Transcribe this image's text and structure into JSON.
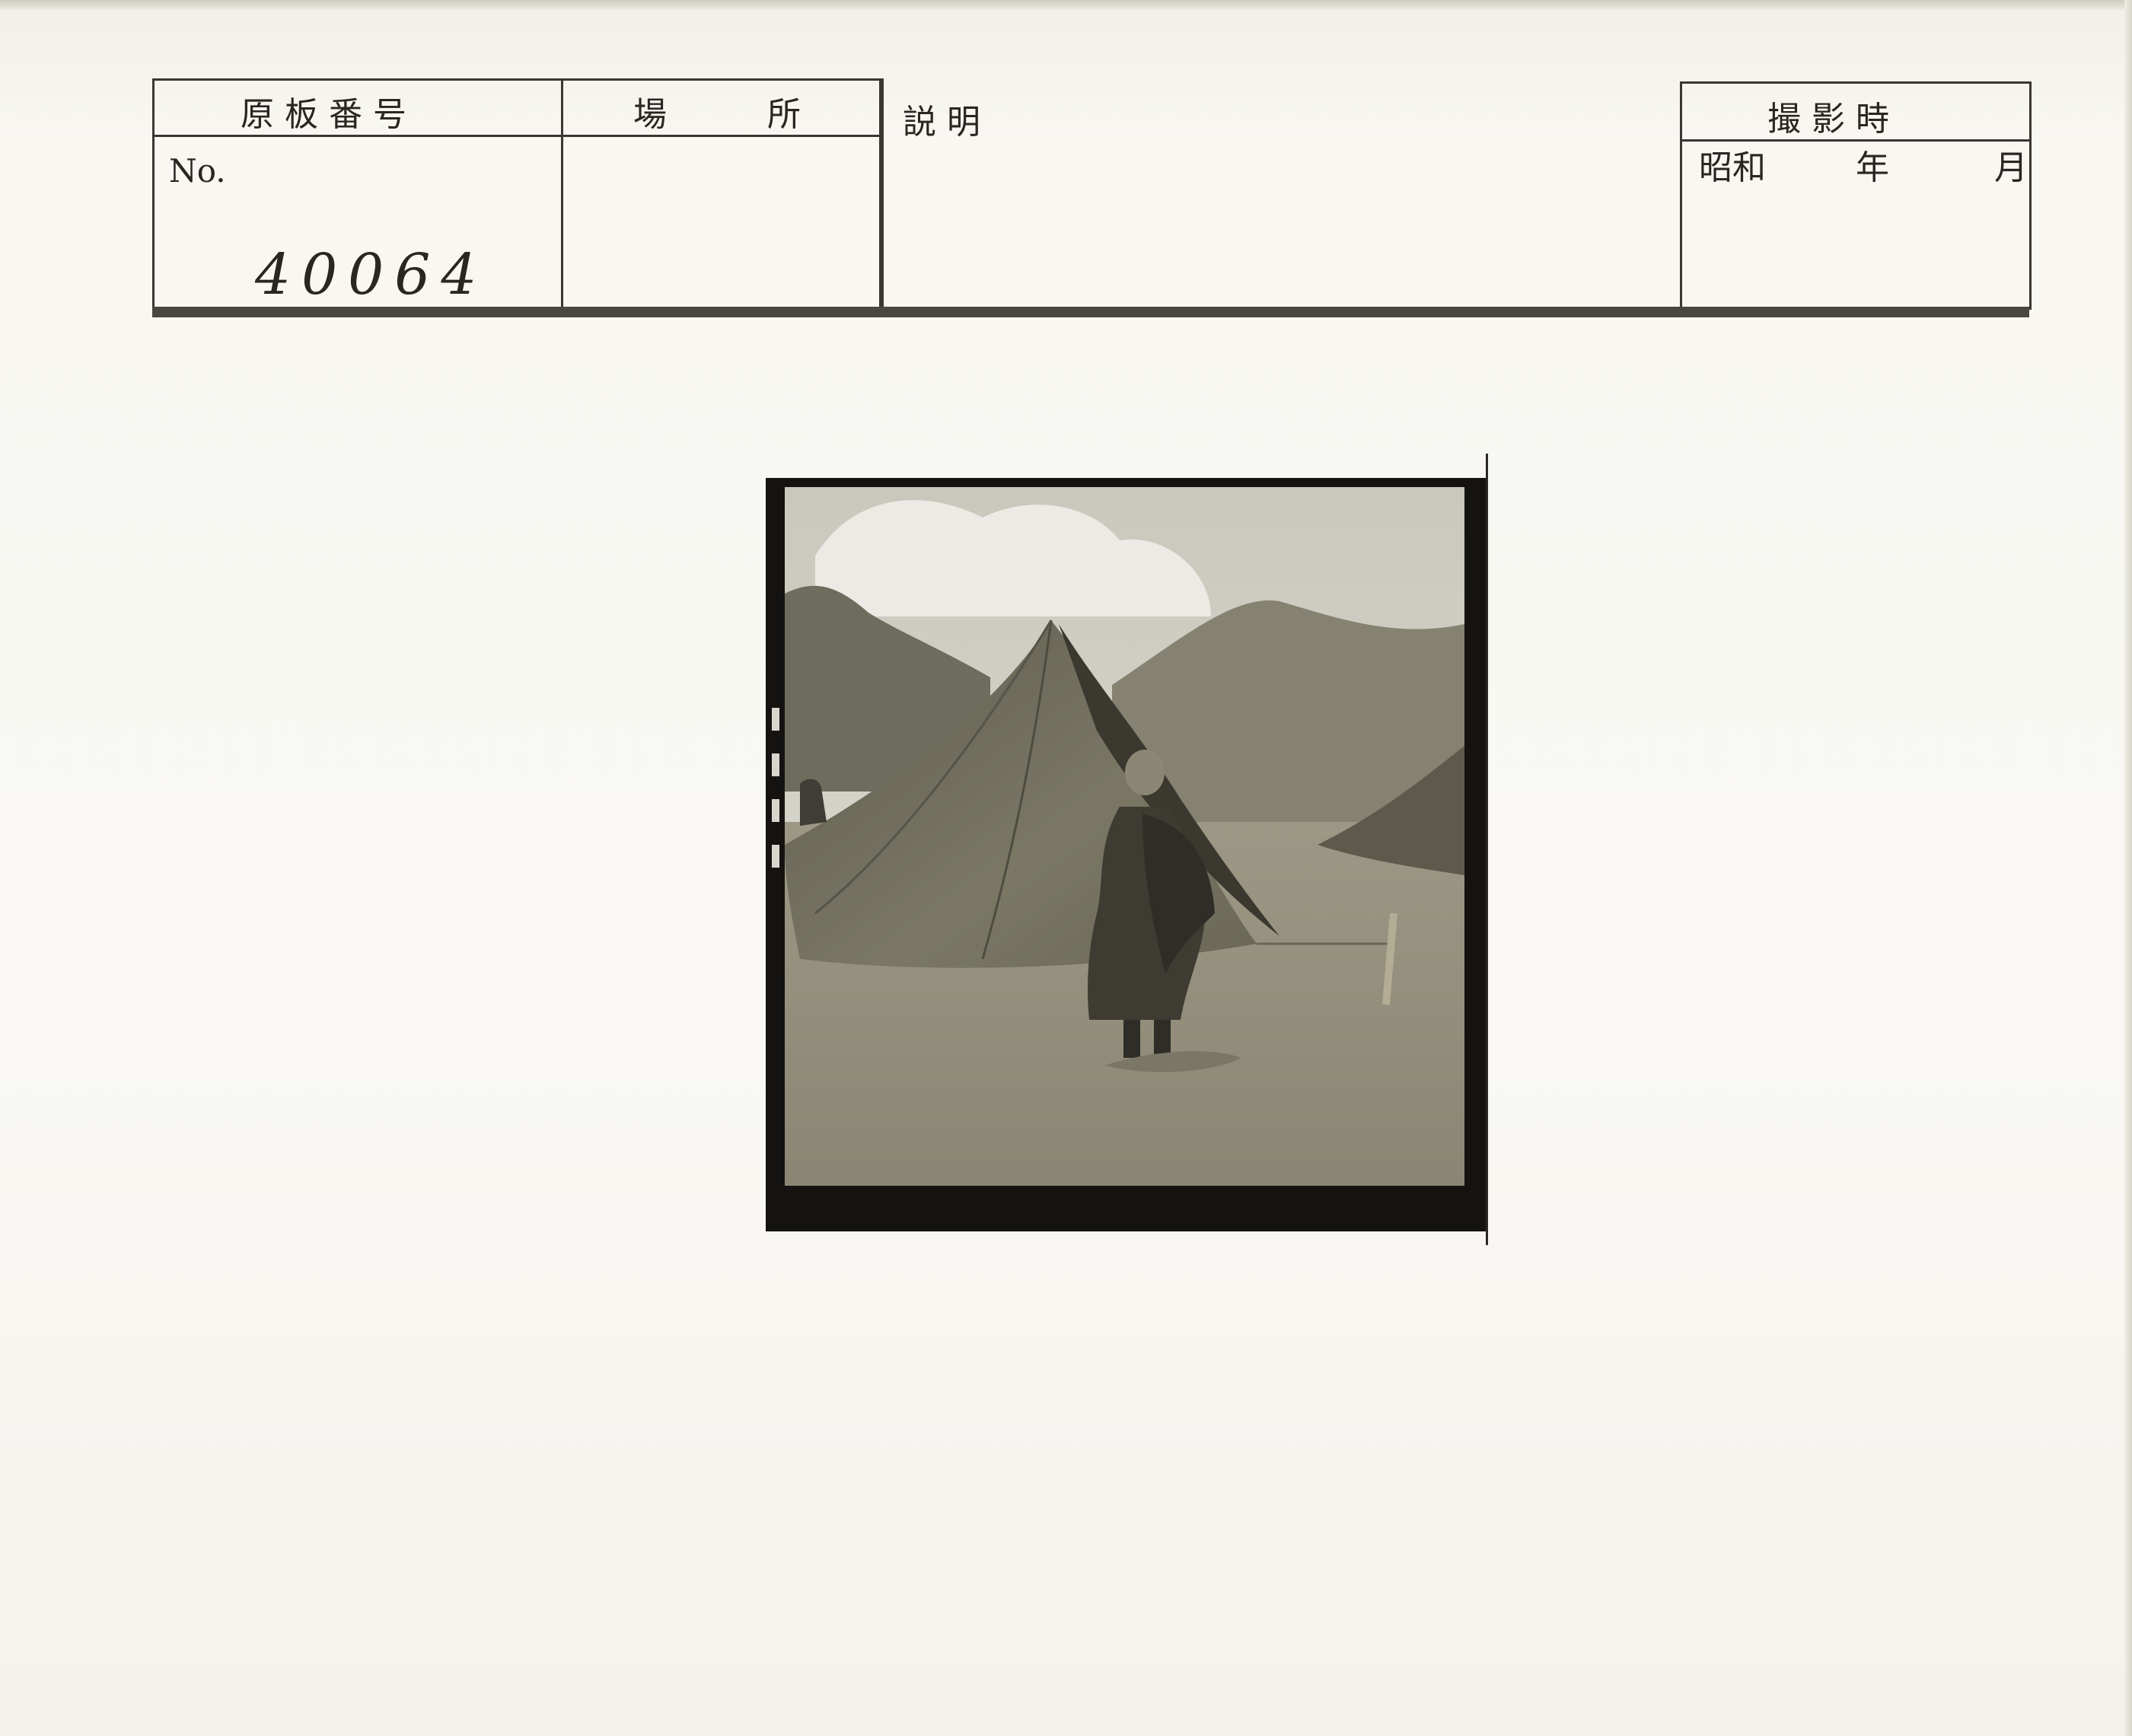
{
  "record_card": {
    "plate_number_header": "原 板 番 号",
    "place_header": "場　　　所",
    "description_header": "説 明",
    "shooting_time_header": "撮 影 時",
    "era": "昭和",
    "year_unit": "年",
    "month_unit": "月",
    "no_prefix": "No.",
    "plate_number_value": "40064"
  },
  "photograph": {
    "subject": "boy-monk-in-robe-before-tent",
    "tone": "#8c8a7a"
  },
  "colors": {
    "paper": "#f8f7f2",
    "ink": "#3b3733",
    "print_border": "#141312"
  }
}
